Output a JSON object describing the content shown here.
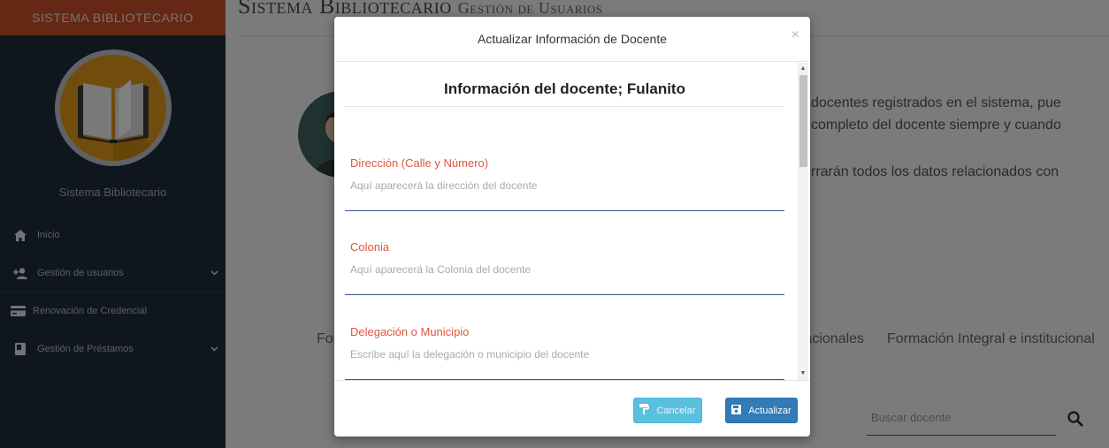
{
  "sidebar": {
    "brand": "SISTEMA BIBLIOTECARIO",
    "logo_name": "Sistema Bibliotecario",
    "items": [
      {
        "label": "Inicio",
        "icon": "home-icon"
      },
      {
        "label": "Gestión de usuarios",
        "icon": "user-plus-icon"
      },
      {
        "label": "Renovación de Credencial",
        "icon": "credit-card-icon"
      },
      {
        "label": "Gestión de Préstamos",
        "icon": "book-icon"
      }
    ]
  },
  "main": {
    "title": "Sistema Bibliotecario",
    "subtitle": "Gestión de Usuarios",
    "paragraph": [
      "docentes registrados en el sistema, puedes",
      "completo del docente siempre y cuando no",
      "rrarán todos los datos relacionados con él,"
    ],
    "tabs": [
      "For",
      "tacionales",
      "Formación Integral e institucional"
    ],
    "search_placeholder": "Buscar docente"
  },
  "modal": {
    "title": "Actualizar Información de Docente",
    "close": "×",
    "body_title": "Información del docente; Fulanito",
    "fields": [
      {
        "label": "Dirección (Calle y Número)",
        "value": "Aquí aparecerá la dirección del docente"
      },
      {
        "label": "Colonia",
        "value": "Aquí aparecerá la Colonia del docente"
      },
      {
        "label": "Delegación o Municipio",
        "value": "Escribe aquí la delegación o municipio del docente"
      }
    ],
    "cancel_label": "Cancelar",
    "update_label": "Actualizar"
  },
  "colors": {
    "brand": "#c8502a",
    "sidebar": "#1f2d3d",
    "label": "#e0553c",
    "cancel": "#5bc0de",
    "primary": "#337ab7"
  }
}
